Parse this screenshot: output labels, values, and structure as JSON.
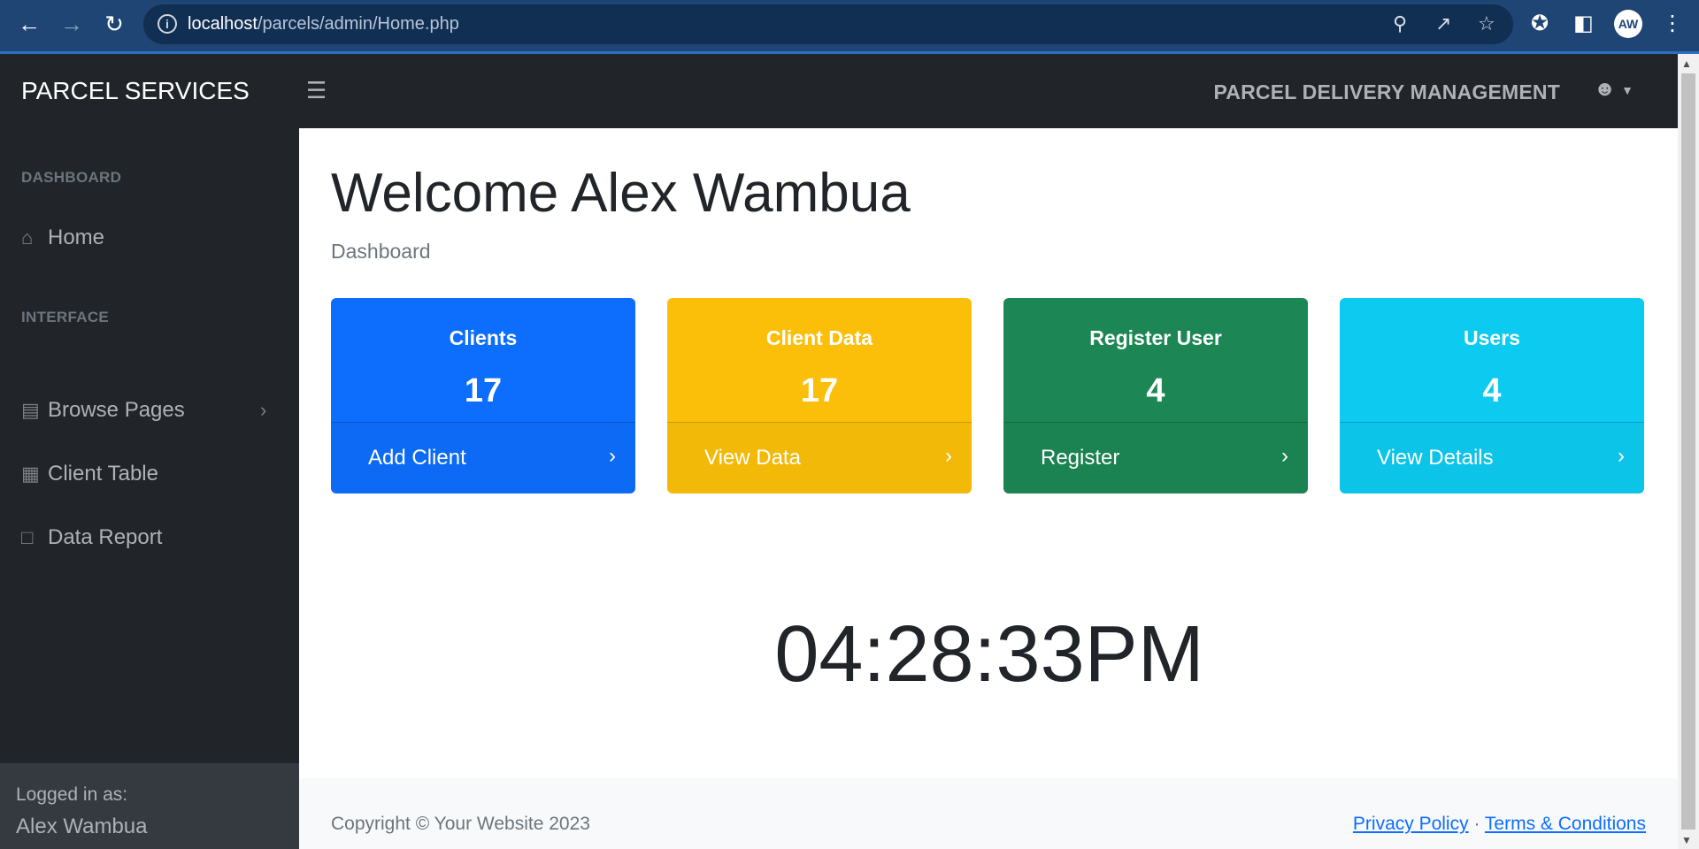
{
  "browser": {
    "url_host": "localhost",
    "url_path": "/parcels/admin/Home.php",
    "profile_initials": "AW"
  },
  "navbar": {
    "brand": "PARCEL SERVICES",
    "title": "PARCEL DELIVERY MANAGEMENT"
  },
  "sidebar": {
    "heading_dashboard": "DASHBOARD",
    "heading_interface": "INTERFACE",
    "items": [
      {
        "label": "Home",
        "icon": "home-icon"
      },
      {
        "label": "Browse Pages",
        "icon": "book-icon"
      },
      {
        "label": "Client Table",
        "icon": "table-icon"
      },
      {
        "label": "Data Report",
        "icon": "pdf-file-icon"
      }
    ],
    "footer_label": "Logged in as:",
    "footer_name": "Alex Wambua"
  },
  "main": {
    "welcome": "Welcome Alex Wambua",
    "breadcrumb": "Dashboard",
    "cards": [
      {
        "title": "Clients",
        "count": "17",
        "link": "Add Client",
        "color": "#0d6efd"
      },
      {
        "title": "Client Data",
        "count": "17",
        "link": "View Data",
        "color": "#fbbf0a"
      },
      {
        "title": "Register User",
        "count": "4",
        "link": "Register",
        "color": "#1c8754"
      },
      {
        "title": "Users",
        "count": "4",
        "link": "View Details",
        "color": "#0dcaf0"
      }
    ],
    "clock": "04:28:33PM"
  },
  "footer": {
    "copyright": "Copyright © Your Website 2023",
    "privacy": "Privacy Policy",
    "separator": "·",
    "terms": "Terms & Conditions"
  }
}
